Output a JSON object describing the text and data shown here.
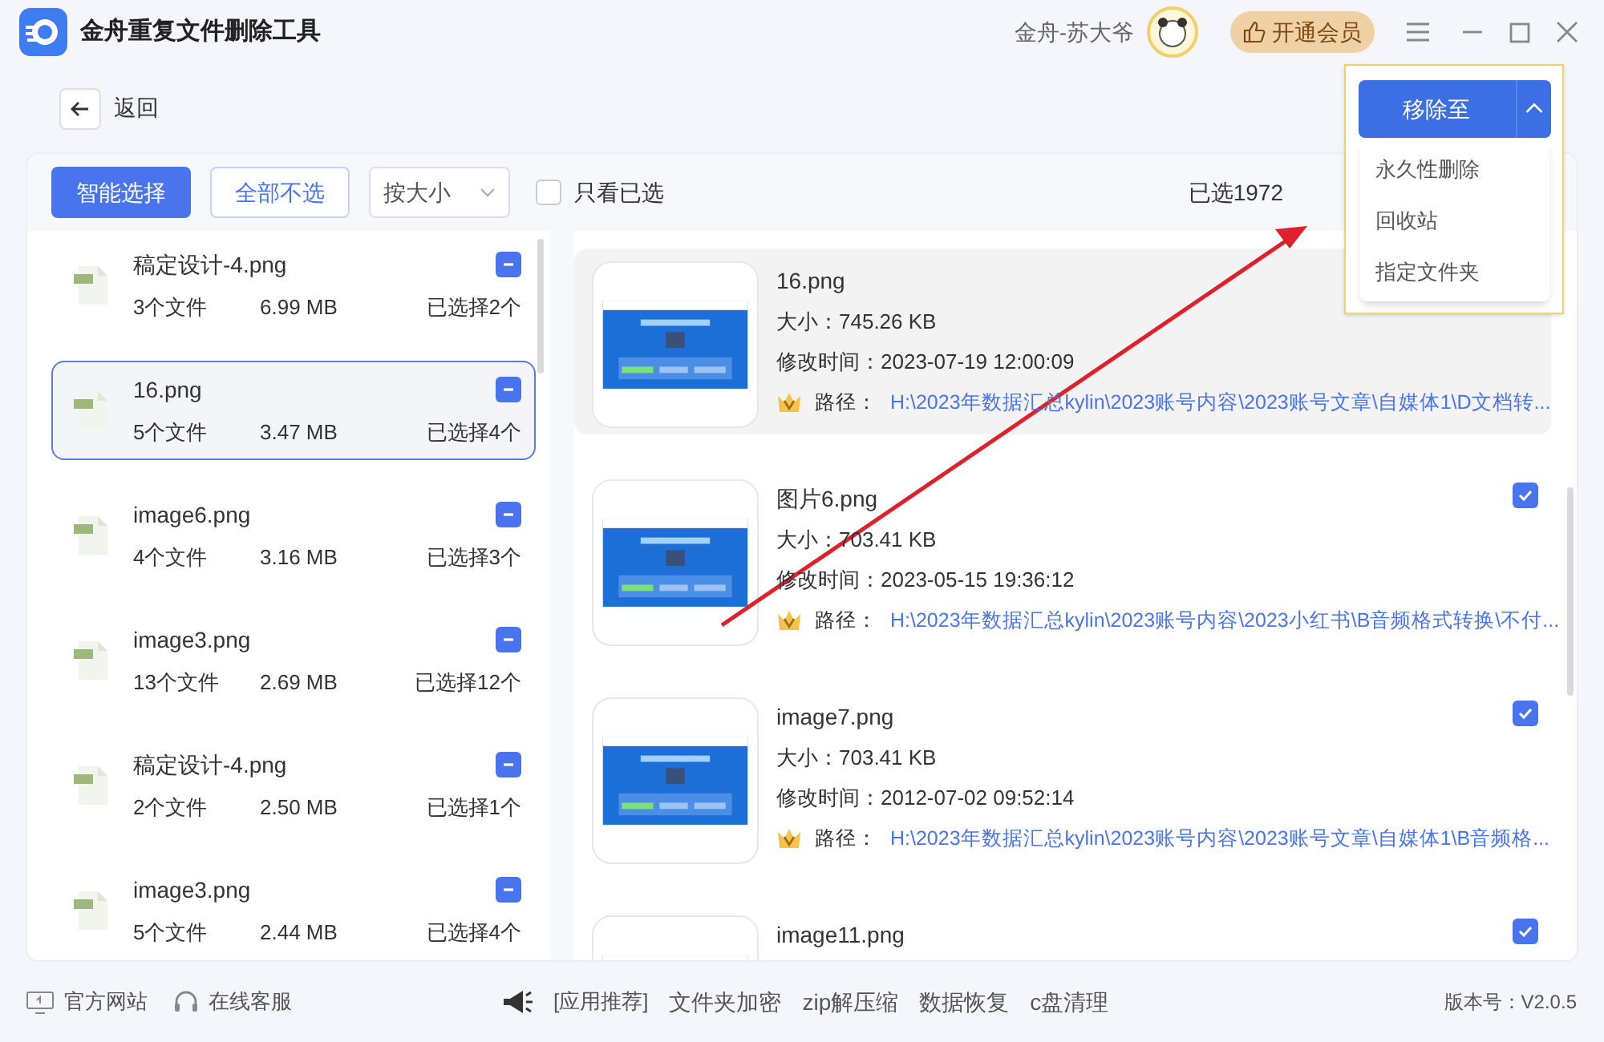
{
  "window": {
    "title": "金舟重复文件删除工具",
    "user": "金舟-苏大爷",
    "vip_button": "开通会员"
  },
  "back_button": "返回",
  "toolbar": {
    "smart_select": "智能选择",
    "deselect_all": "全部不选",
    "sort": "按大小",
    "only_selected": {
      "label": "只看已选",
      "checked": false
    },
    "selected_summary": "已选1972"
  },
  "move_menu": {
    "button": "移除至",
    "items": [
      "永久性删除",
      "回收站",
      "指定文件夹"
    ]
  },
  "groups": [
    {
      "name": "稿定设计-4.png",
      "count": "3个文件",
      "size": "6.99 MB",
      "picked": "已选择2个",
      "selected": false
    },
    {
      "name": "16.png",
      "count": "5个文件",
      "size": "3.47 MB",
      "picked": "已选择4个",
      "selected": true
    },
    {
      "name": "image6.png",
      "count": "4个文件",
      "size": "3.16 MB",
      "picked": "已选择3个",
      "selected": false
    },
    {
      "name": "image3.png",
      "count": "13个文件",
      "size": "2.69 MB",
      "picked": "已选择12个",
      "selected": false
    },
    {
      "name": "稿定设计-4.png",
      "count": "2个文件",
      "size": "2.50 MB",
      "picked": "已选择1个",
      "selected": false
    },
    {
      "name": "image3.png",
      "count": "5个文件",
      "size": "2.44 MB",
      "picked": "已选择4个",
      "selected": false
    }
  ],
  "files": [
    {
      "name": "16.png",
      "size": "大小：745.26 KB",
      "modified": "修改时间：2023-07-19 12:00:09",
      "path_label": "路径：",
      "path": "H:\\2023年数据汇总kylin\\2023账号内容\\2023账号文章\\自媒体1\\D文档转...",
      "highlighted": true
    },
    {
      "name": "图片6.png",
      "size": "大小：703.41 KB",
      "modified": "修改时间：2023-05-15 19:36:12",
      "path_label": "路径：",
      "path": "H:\\2023年数据汇总kylin\\2023账号内容\\2023小红书\\B音频格式转换\\不付...",
      "checked": true,
      "highlighted": false
    },
    {
      "name": "image7.png",
      "size": "大小：703.41 KB",
      "modified": "修改时间：2012-07-02 09:52:14",
      "path_label": "路径：",
      "path": "H:\\2023年数据汇总kylin\\2023账号内容\\2023账号文章\\自媒体1\\B音频格...",
      "checked": true,
      "highlighted": false
    },
    {
      "name": "image11.png",
      "checked": true,
      "highlighted": false
    }
  ],
  "footer": {
    "website": "官方网站",
    "support": "在线客服",
    "promo_label": "[应用推荐]",
    "promo_links": [
      "文件夹加密",
      "zip解压缩",
      "数据恢复",
      "c盘清理"
    ],
    "version": "版本号：V2.0.5"
  }
}
